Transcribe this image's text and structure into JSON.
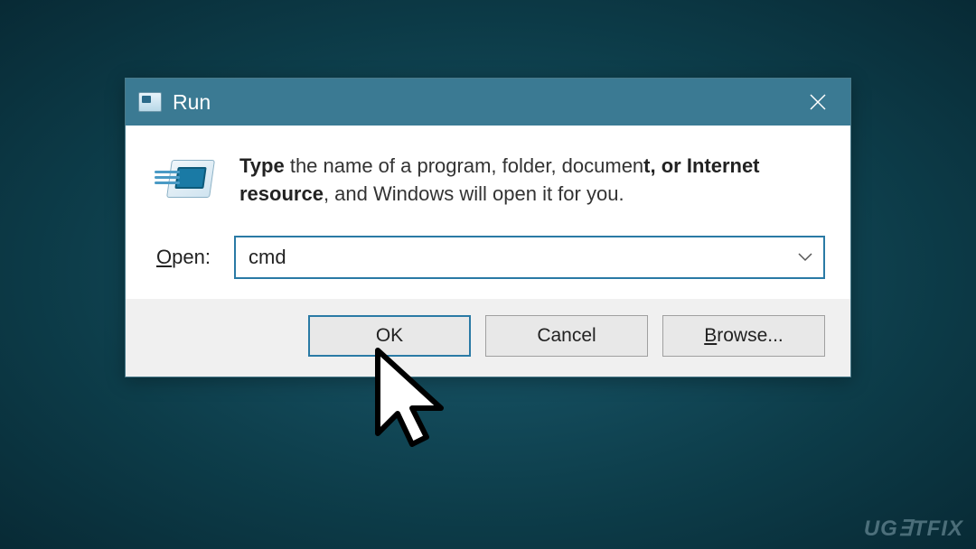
{
  "dialog": {
    "title": "Run",
    "description_bold1": "Type ",
    "description_mid": "the name of a program, folder, documen",
    "description_bold2": "t, or Internet resource",
    "description_rest": ", and Windows will open it for you.",
    "open_label_u": "O",
    "open_label_rest": "pen:",
    "input_value": "cmd",
    "buttons": {
      "ok": "OK",
      "cancel": "Cancel",
      "browse_u": "B",
      "browse_rest": "rowse..."
    }
  },
  "watermark": "UG∃TFIX"
}
